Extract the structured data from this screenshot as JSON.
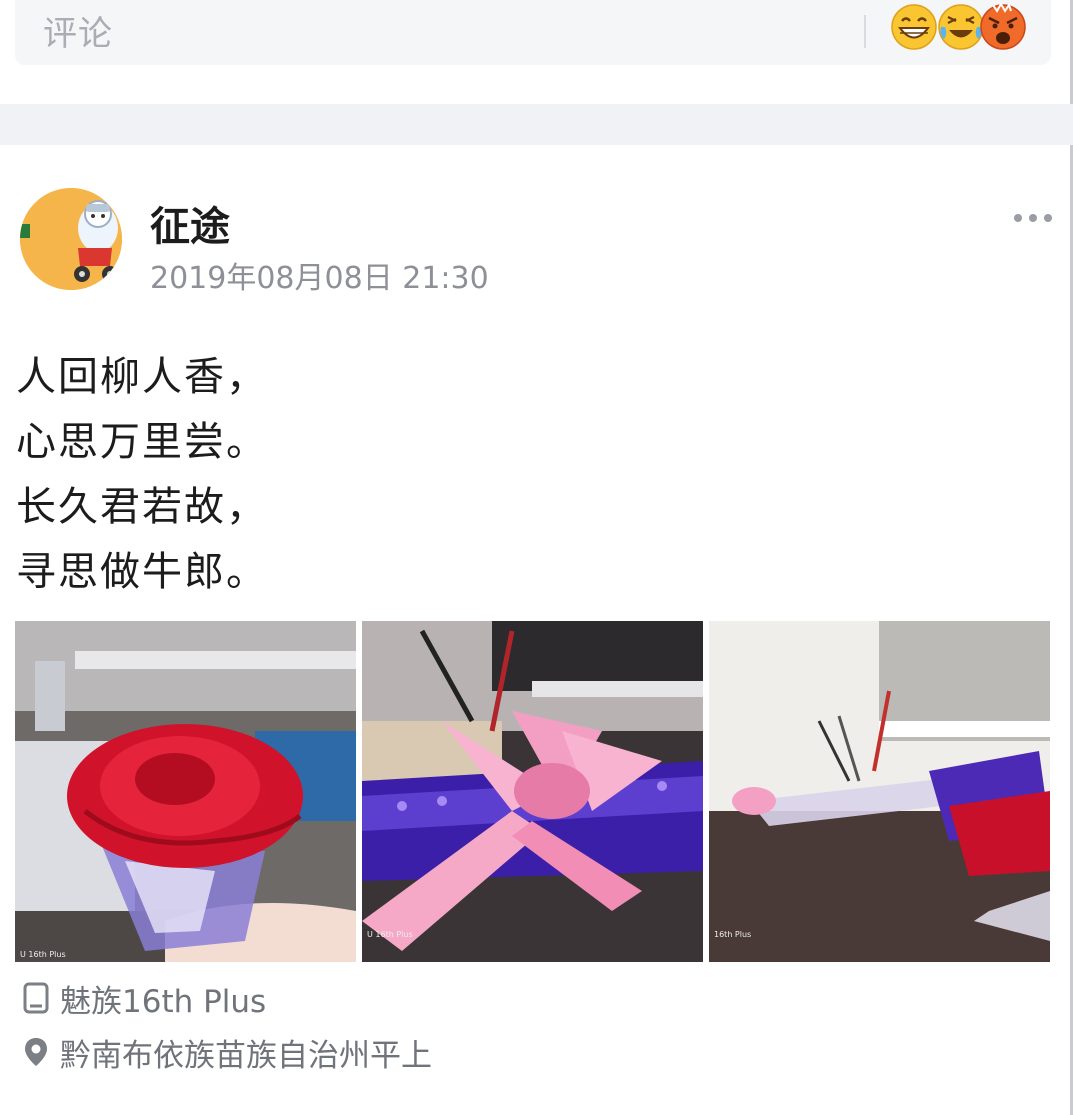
{
  "comment_bar": {
    "placeholder": "评论",
    "emojis": [
      "grinning-face-icon",
      "tears-of-joy-face-icon",
      "angry-face-icon"
    ]
  },
  "post": {
    "author": "征途",
    "time": "2019年08月08日 21:30",
    "poem_lines": [
      "人回柳人香，",
      "心思万里尝。",
      "长久君若故，",
      "寻思做牛郎。"
    ],
    "photos": [
      "rose-photo",
      "pink-ribbon-photo",
      "desk-flower-photo"
    ],
    "photo_watermarks": [
      "U 16th Plus",
      "16th Plus"
    ],
    "device": "魅族16th Plus",
    "location": "黔南布依族苗族自治州平上"
  },
  "colors": {
    "background": "#ffffff",
    "separator": "#f1f2f5",
    "meta_text": "#6f737a",
    "time_text": "#8d9097"
  }
}
